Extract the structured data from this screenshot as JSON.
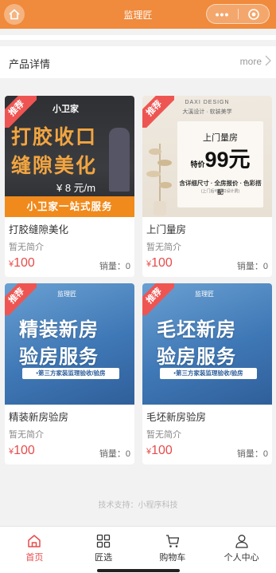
{
  "app": {
    "title": "监理匠",
    "more_label": "•••"
  },
  "section": {
    "title": "产品详情",
    "more_label": "more"
  },
  "products": [
    {
      "name": "打胶缝隙美化",
      "desc": "暂无简介",
      "currency": "¥",
      "price": "100",
      "sales": "销量：0",
      "badge": "推荐",
      "image": {
        "brand": "小卫家",
        "line1": "打胶收口",
        "line2": "缝隙美化",
        "price_text": "¥ 8 元/m",
        "bar_text": "小卫家一站式服务"
      }
    },
    {
      "name": "上门量房",
      "desc": "暂无简介",
      "currency": "¥",
      "price": "100",
      "sales": "销量：0",
      "badge": "推荐",
      "image": {
        "head": "DAXI DESIGN",
        "sub": "大溪设计 · 软装美学",
        "line1": "上门量房",
        "special": "特价",
        "big": "99元",
        "line3": "含详细尺寸 · 全房报价 · 色彩搭配",
        "line4": "(上门后可抵扣设计费)"
      }
    },
    {
      "name": "精装新房验房",
      "desc": "暂无简介",
      "currency": "¥",
      "price": "100",
      "sales": "销量：0",
      "badge": "推荐",
      "image": {
        "logo": "监理匠",
        "line1": "精装新房",
        "line2": "验房服务",
        "pill": "•第三方家装监理验收/验房"
      }
    },
    {
      "name": "毛坯新房验房",
      "desc": "暂无简介",
      "currency": "¥",
      "price": "100",
      "sales": "销量：0",
      "badge": "推荐",
      "image": {
        "logo": "监理匠",
        "line1": "毛坯新房",
        "line2": "验房服务",
        "pill": "•第三方家装监理验收/验房"
      }
    }
  ],
  "footer_note": "技术支持：小程序科技",
  "tabbar": [
    {
      "label": "首页",
      "icon": "home-icon",
      "active": true
    },
    {
      "label": "匠选",
      "icon": "grid-icon",
      "active": false
    },
    {
      "label": "购物车",
      "icon": "cart-icon",
      "active": false
    },
    {
      "label": "个人中心",
      "icon": "user-icon",
      "active": false
    }
  ],
  "colors": {
    "header": "#f08a3c",
    "price": "#e94b4b",
    "badge": "#ee5552"
  }
}
